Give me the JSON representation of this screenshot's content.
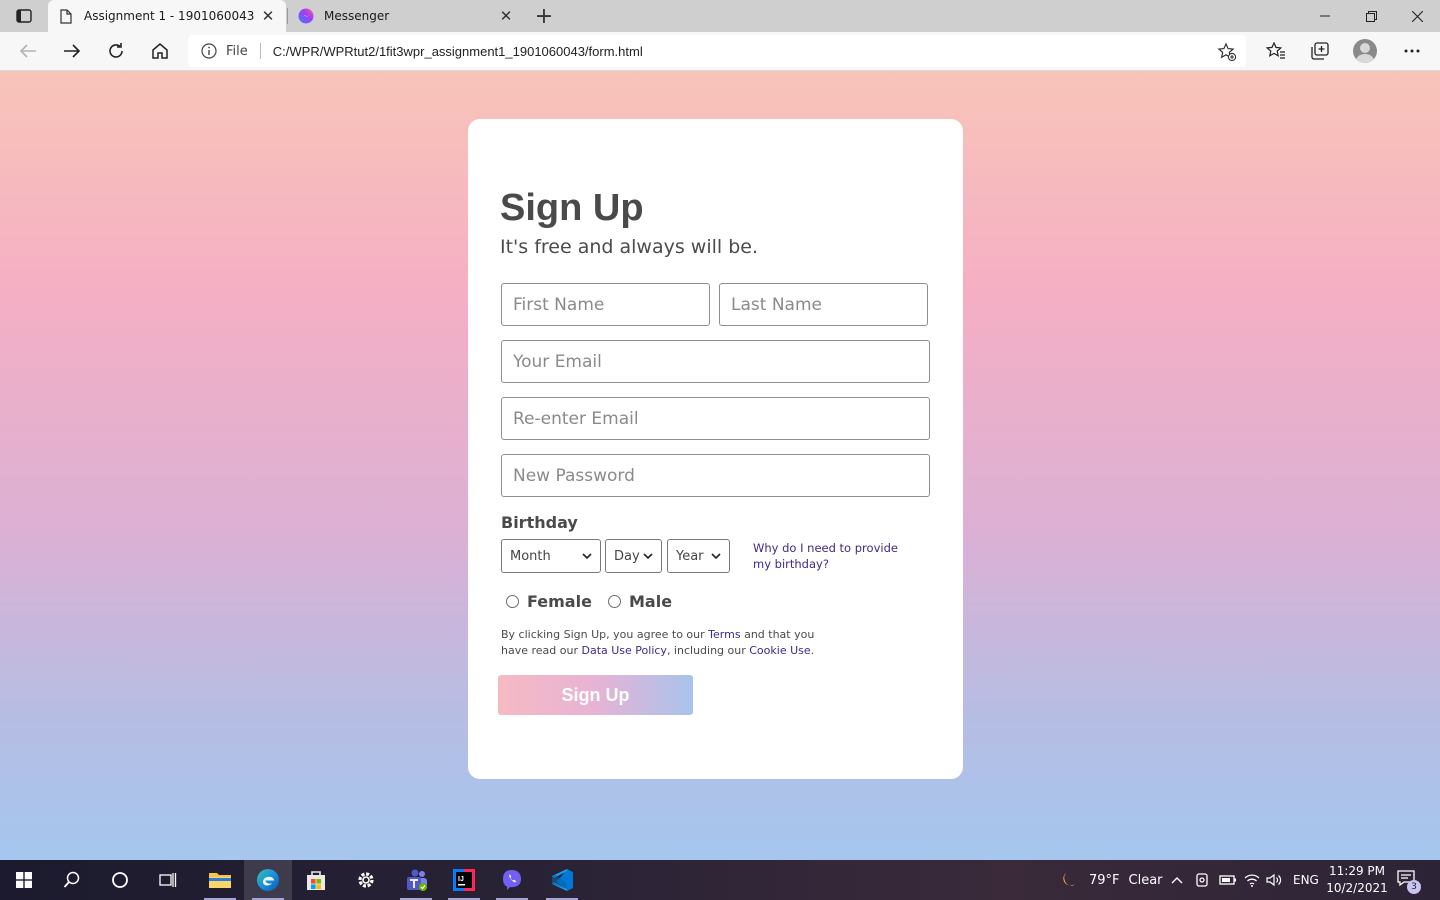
{
  "browser": {
    "tabs": [
      {
        "title": "Assignment 1 - 1901060043",
        "icon": "document-icon",
        "active": true
      },
      {
        "title": "Messenger",
        "icon": "messenger-icon",
        "active": false
      }
    ],
    "address": {
      "scheme_label": "File",
      "url": "C:/WPR/WPRtut2/1fit3wpr_assignment1_1901060043/form.html"
    }
  },
  "form": {
    "title": "Sign Up",
    "subtitle": "It's free and always will be.",
    "fields": {
      "first_name_placeholder": "First Name",
      "last_name_placeholder": "Last Name",
      "email_placeholder": "Your Email",
      "reenter_email_placeholder": "Re-enter Email",
      "password_placeholder": "New Password"
    },
    "birthday": {
      "label": "Birthday",
      "month": "Month",
      "day": "Day",
      "year": "Year",
      "why_link": "Why do I need to provide my birthday?"
    },
    "gender": {
      "female": "Female",
      "male": "Male"
    },
    "terms": {
      "t1": "By clicking Sign Up, you agree to our ",
      "terms_link": "Terms",
      "t2": " and that you have read our ",
      "data_policy_link": "Data Use Policy",
      "t3": ", including our ",
      "cookie_link": "Cookie Use",
      "t4": "."
    },
    "submit_label": "Sign Up"
  },
  "taskbar": {
    "weather_temp": "79°F",
    "weather_text": "Clear",
    "language": "ENG",
    "time": "11:29 PM",
    "date": "10/2/2021",
    "notification_count": "3"
  }
}
